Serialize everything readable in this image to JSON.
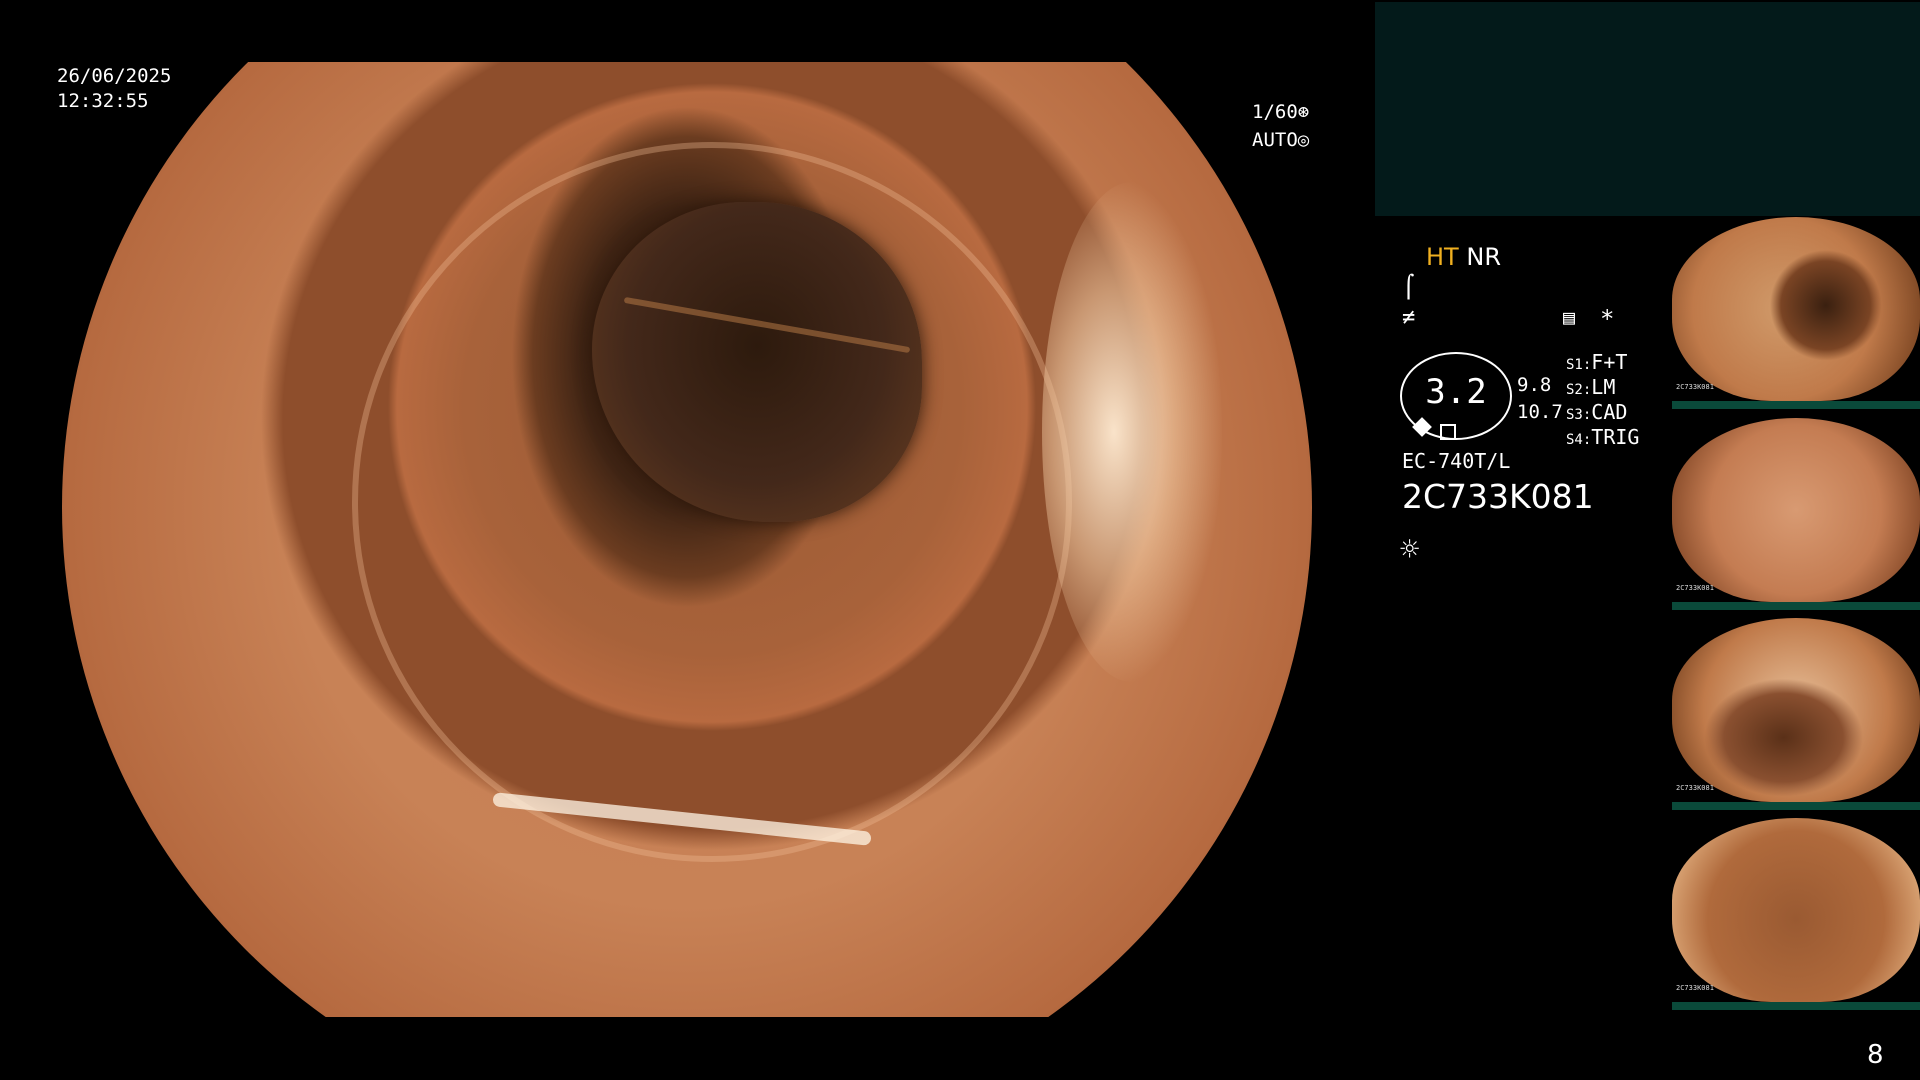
{
  "osd": {
    "date": "26/06/2025",
    "time": "12:32:55",
    "shutter": "1/60⊛",
    "iris": "AUTO◎"
  },
  "status": {
    "ht": "HT",
    "nr": "NR",
    "mode_icon_1": "⌠",
    "mode_icon_2": "≠",
    "mode_icon_3": "▤",
    "mode_icon_4": "*"
  },
  "zoom": {
    "value": "3.2",
    "value_a": "9.8",
    "value_b": "10.7"
  },
  "switches": [
    {
      "key": "S1:",
      "label": "F+T"
    },
    {
      "key": "S2:",
      "label": "LM"
    },
    {
      "key": "S3:",
      "label": "CAD"
    },
    {
      "key": "S4:",
      "label": "TRIG"
    }
  ],
  "scope": {
    "model": "EC-740T/L",
    "serial": "2C733K081",
    "light_icon": "☼"
  },
  "thumbnails": [
    {
      "caption": "2C733K081"
    },
    {
      "caption": "2C733K081"
    },
    {
      "caption": "2C733K081"
    },
    {
      "caption": "2C733K081"
    }
  ],
  "page_number": "8"
}
